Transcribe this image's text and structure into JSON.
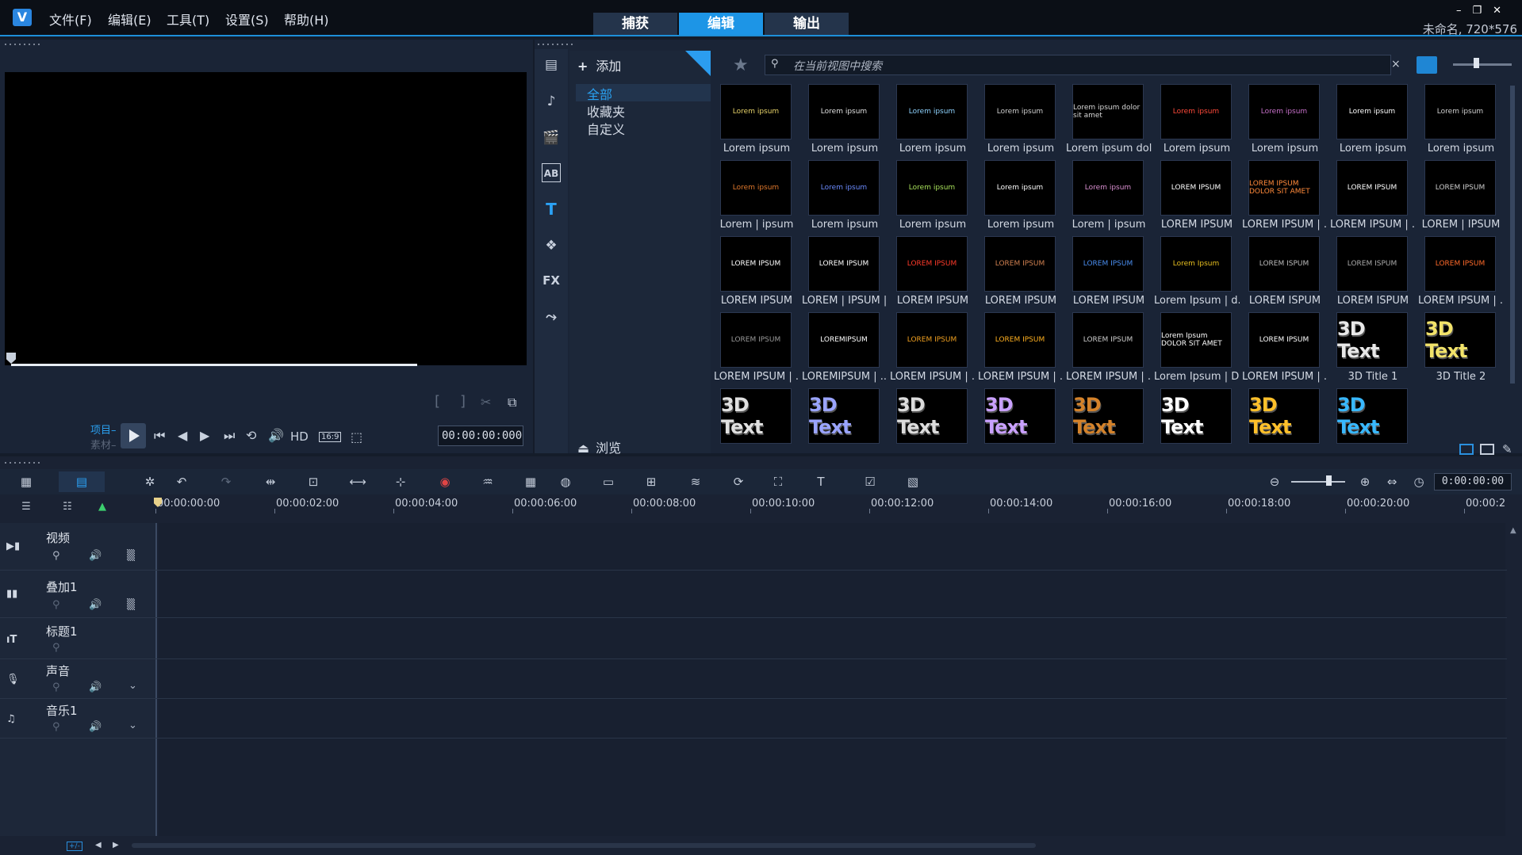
{
  "app": {
    "logo": "V",
    "menu": [
      "文件(F)",
      "编辑(E)",
      "工具(T)",
      "设置(S)",
      "帮助(H)"
    ],
    "mode_tabs": [
      "捕获",
      "编辑",
      "输出"
    ],
    "active_tab": "编辑",
    "window_controls": [
      "–",
      "❐",
      "✕"
    ],
    "project_info": "未命名, 720*576"
  },
  "preview": {
    "mode_project": "项目–",
    "mode_clip": "素材–",
    "hd_label": "HD",
    "aspect": "16:9",
    "timecode": "00:00:00:000",
    "bracket_in": "[",
    "bracket_out": "]"
  },
  "library": {
    "add_label": "添加",
    "folders": [
      "全部",
      "收藏夹",
      "自定义"
    ],
    "selected_folder": "全部",
    "browse_label": "浏览",
    "search_placeholder": "在当前视图中搜索",
    "search_clear": "×",
    "side_icons": [
      "media-icon",
      "audio-icon",
      "instant-project-icon",
      "transition-icon",
      "title-icon",
      "graphics-icon",
      "fx-icon",
      "path-icon"
    ],
    "fx_label": "FX",
    "title_icon_label": "T",
    "thumbnails": [
      {
        "label": "Lorem ipsum",
        "preview": "Lorem ipsum",
        "color": "#e8d46a"
      },
      {
        "label": "Lorem ipsum",
        "preview": "Lorem ipsum",
        "color": "#e0e0e0"
      },
      {
        "label": "Lorem ipsum",
        "preview": "Lorem ipsum",
        "color": "#8fd3ff"
      },
      {
        "label": "Lorem ipsum",
        "preview": "Lorem ipsum",
        "color": "#cfcfcf"
      },
      {
        "label": "Lorem ipsum dol...",
        "preview": "Lorem ipsum dolor sit amet",
        "color": "#d8d8d8"
      },
      {
        "label": "Lorem ipsum",
        "preview": "Lorem ipsum",
        "color": "#ff4a3a"
      },
      {
        "label": "Lorem ipsum",
        "preview": "Lorem ipsum",
        "color": "#c770c9"
      },
      {
        "label": "Lorem ipsum",
        "preview": "Lorem ipsum",
        "color": "#ffffff"
      },
      {
        "label": "Lorem ipsum",
        "preview": "Lorem ipsum",
        "color": "#d0d0d0"
      },
      {
        "label": "Lorem | ipsum",
        "preview": "Lorem ipsum",
        "color": "#e0782c"
      },
      {
        "label": "Lorem ipsum",
        "preview": "Lorem ipsum",
        "color": "#6c8cff"
      },
      {
        "label": "Lorem ipsum",
        "preview": "Lorem ipsum",
        "color": "#a7e05a"
      },
      {
        "label": "Lorem ipsum",
        "preview": "Lorem ipsum",
        "color": "#ffffff"
      },
      {
        "label": "Lorem | ipsum",
        "preview": "Lorem ipsum",
        "color": "#d98fd0"
      },
      {
        "label": "LOREM IPSUM",
        "preview": "LOREM IPSUM",
        "color": "#ffffff"
      },
      {
        "label": "LOREM IPSUM | ...",
        "preview": "LOREM IPSUM DOLOR SIT AMET",
        "color": "#ff8a3a"
      },
      {
        "label": "LOREM IPSUM | ...",
        "preview": "LOREM IPSUM",
        "color": "#ffffff"
      },
      {
        "label": "LOREM | IPSUM",
        "preview": "LOREM IPSUM",
        "color": "#cccccc"
      },
      {
        "label": "LOREM IPSUM",
        "preview": "LOREM IPSUM",
        "color": "#ffffff"
      },
      {
        "label": "LOREM | IPSUM |...",
        "preview": "LOREM IPSUM",
        "color": "#ffffff"
      },
      {
        "label": "LOREM IPSUM",
        "preview": "LOREM IPSUM",
        "color": "#ff3a2a"
      },
      {
        "label": "LOREM IPSUM",
        "preview": "LOREM IPSUM",
        "color": "#d08050"
      },
      {
        "label": "LOREM IPSUM",
        "preview": "LOREM IPSUM",
        "color": "#4a8ef0"
      },
      {
        "label": "Lorem Ipsum | d...",
        "preview": "Lorem Ipsum",
        "color": "#e8c020"
      },
      {
        "label": "LOREM ISPUM",
        "preview": "LOREM ISPUM",
        "color": "#bbbbbb"
      },
      {
        "label": "LOREM ISPUM",
        "preview": "LOREM ISPUM",
        "color": "#aaaaaa"
      },
      {
        "label": "LOREM IPSUM | ...",
        "preview": "LOREM IPSUM",
        "color": "#ff6a2a"
      },
      {
        "label": "LOREM IPSUM | ...",
        "preview": "LOREM IPSUM",
        "color": "#9a9a9a"
      },
      {
        "label": "LOREMIPSUM | ...",
        "preview": "LOREMIPSUM",
        "color": "#ffffff"
      },
      {
        "label": "LOREM IPSUM | ...",
        "preview": "LOREM IPSUM",
        "color": "#f0a020"
      },
      {
        "label": "LOREM IPSUM | ...",
        "preview": "LOREM IPSUM",
        "color": "#ffb020"
      },
      {
        "label": "LOREM IPSUM | ...",
        "preview": "LOREM IPSUM",
        "color": "#cccccc"
      },
      {
        "label": "Lorem Ipsum | D...",
        "preview": "Lorem Ipsum DOLOR SIT AMET",
        "color": "#ffffff"
      },
      {
        "label": "LOREM IPSUM | ...",
        "preview": "LOREM IPSUM",
        "color": "#ffffff"
      },
      {
        "label": "3D Title 1",
        "preview": "3D Text",
        "color": "#e8e8e8"
      },
      {
        "label": "3D Title 2",
        "preview": "3D Text",
        "color": "#f2e36a"
      },
      {
        "label": "",
        "preview": "3D Text",
        "color": "#e0e0e0"
      },
      {
        "label": "",
        "preview": "3D Text",
        "color": "#9aa4ff"
      },
      {
        "label": "",
        "preview": "3D Text",
        "color": "#dcdcdc"
      },
      {
        "label": "",
        "preview": "3D Text",
        "color": "#c9a0ff"
      },
      {
        "label": "",
        "preview": "3D Text",
        "color": "#d4822a"
      },
      {
        "label": "",
        "preview": "3D Text",
        "color": "#ffffff"
      },
      {
        "label": "",
        "preview": "3D Text",
        "color": "#ffc02a"
      },
      {
        "label": "",
        "preview": "3D Text",
        "color": "#38b8ff"
      }
    ]
  },
  "timeline": {
    "timecode": "0:00:00:00",
    "ruler": [
      "00:00:00:00",
      "00:00:02:00",
      "00:00:04:00",
      "00:00:06:00",
      "00:00:08:00",
      "00:00:10:00",
      "00:00:12:00",
      "00:00:14:00",
      "00:00:16:00",
      "00:00:18:00",
      "00:00:20:00",
      "00:00:2"
    ],
    "tracks": [
      {
        "name": "视频"
      },
      {
        "name": "叠加1"
      },
      {
        "name": "标题1"
      },
      {
        "name": "声音"
      },
      {
        "name": "音乐1"
      }
    ],
    "footer_label": "+/-"
  },
  "colors": {
    "accent": "#1d95e6",
    "background": "#1a2436"
  }
}
